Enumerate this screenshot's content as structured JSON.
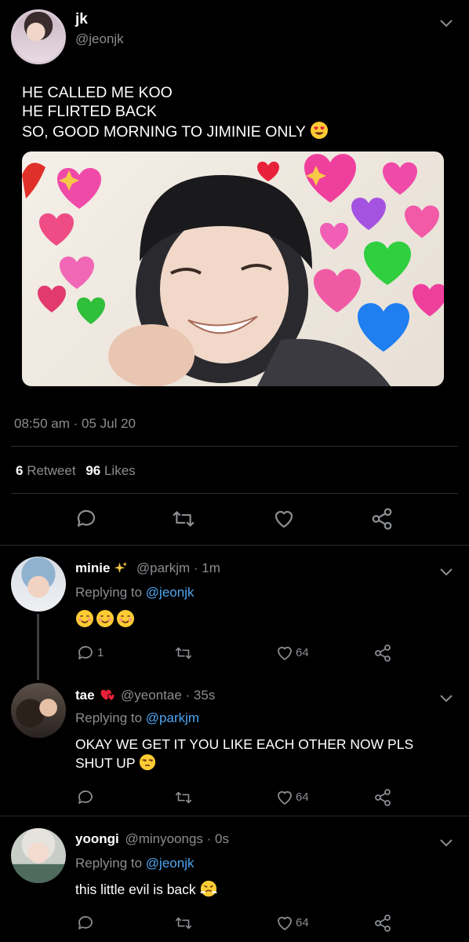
{
  "tweet": {
    "name": "jk",
    "handle": "@jeonjk",
    "text_lines": [
      "HE CALLED ME KOO",
      "HE FLIRTED BACK",
      "SO, GOOD MORNING TO JIMINIE ONLY"
    ],
    "text_emoji": "heart-eyes-emoji",
    "timestamp": "08:50 am · 05 Jul 20",
    "retweets_count": "6",
    "retweets_label": "Retweet",
    "likes_count": "96",
    "likes_label": "Likes"
  },
  "replies": [
    {
      "name": "minie",
      "name_emoji": "sparkles-emoji",
      "handle_time": "@parkjm · 1m",
      "replying_prefix": "Replying to",
      "replying_to": "@jeonjk",
      "text": "",
      "text_emoji": "smiling-face-emoji x3",
      "reply_count": "1",
      "like_count": "64"
    },
    {
      "name": "tae",
      "name_emoji": "heart-exclamation-emoji",
      "handle_time": "@yeontae · 35s",
      "replying_prefix": "Replying to",
      "replying_to": "@parkjm",
      "text_line1": "OKAY WE GET IT YOU LIKE EACH OTHER NOW PLS",
      "text_line2": "SHUT UP",
      "text_emoji": "unamused-face-emoji",
      "like_count": "64"
    },
    {
      "name": "yoongi",
      "handle_time": "@minyoongs · 0s",
      "replying_prefix": "Replying to",
      "replying_to": "@jeonjk",
      "text": "this little evil is back",
      "text_emoji": "face-with-steam-emoji",
      "like_count": "64"
    }
  ],
  "colors": {
    "background": "#000000",
    "muted": "#8a8d91",
    "link": "#4ea4f0",
    "divider": "#2a2d31"
  }
}
